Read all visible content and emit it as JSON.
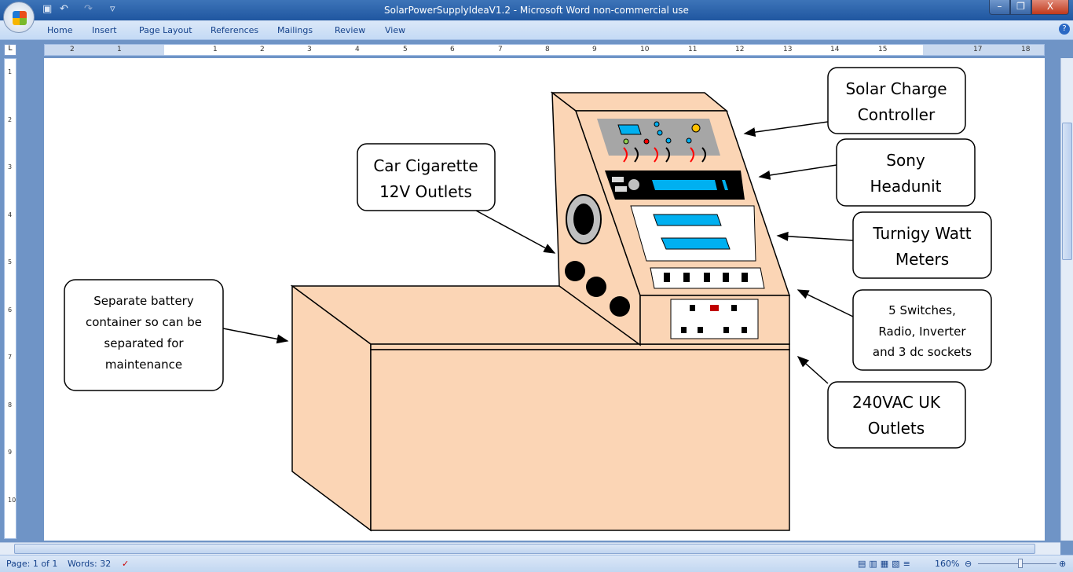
{
  "window": {
    "title": "SolarPowerSupplyIdeaV1.2 - Microsoft Word non-commercial use",
    "minimize": "–",
    "restore": "❐",
    "close": "X"
  },
  "quick_access": {
    "save_icon": "floppy-icon",
    "undo_icon": "↶",
    "redo_icon": "↷",
    "customize": "▿"
  },
  "ribbon": {
    "tabs": [
      "Home",
      "Insert",
      "Page Layout",
      "References",
      "Mailings",
      "Review",
      "View"
    ],
    "help": "?"
  },
  "ruler": {
    "horizontal": [
      "2",
      "1",
      "1",
      "2",
      "3",
      "4",
      "5",
      "6",
      "7",
      "8",
      "9",
      "10",
      "11",
      "12",
      "13",
      "14",
      "15",
      "17",
      "18"
    ],
    "vertical": [
      "1",
      "2",
      "3",
      "4",
      "5",
      "6",
      "7",
      "8",
      "9",
      "10"
    ],
    "tab_selector": "L"
  },
  "diagram": {
    "colors": {
      "box": "#fbd5b5",
      "panel_grey": "#a6a6a6",
      "display": "#00b0f0"
    },
    "callouts": {
      "solar": [
        "Solar Charge",
        "Controller"
      ],
      "sony": [
        "Sony",
        "Headunit"
      ],
      "turnigy": [
        "Turnigy Watt",
        "Meters"
      ],
      "switches": [
        "5 Switches,",
        "Radio, Inverter",
        "and 3 dc sockets"
      ],
      "outlets": [
        "240VAC UK",
        "Outlets"
      ],
      "car": [
        "Car Cigarette",
        "12V Outlets"
      ],
      "battery": [
        "Separate battery",
        "container so can be",
        "separated for",
        "maintenance"
      ]
    }
  },
  "status": {
    "page": "Page: 1 of 1",
    "words": "Words: 32",
    "zoom": "160%",
    "zoom_level_percent": 160
  }
}
